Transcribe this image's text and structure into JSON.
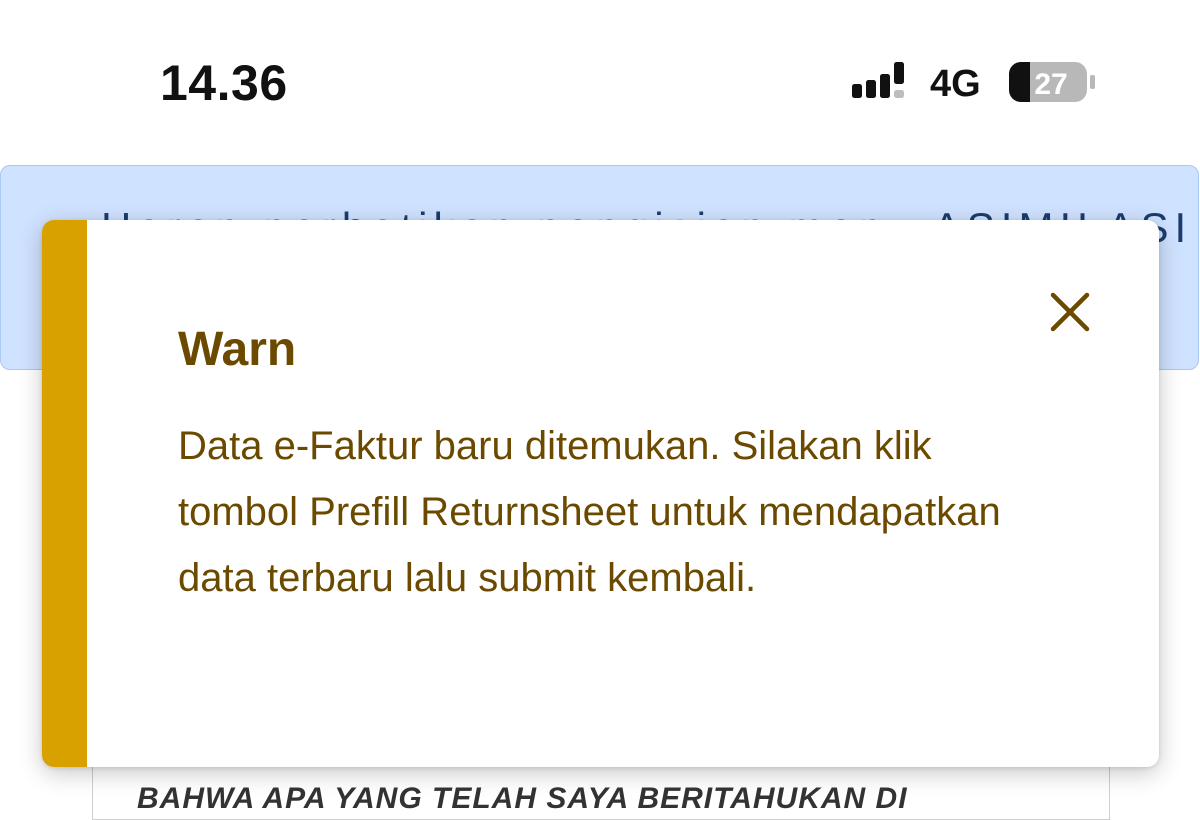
{
  "status_bar": {
    "time": "14.36",
    "network": "4G",
    "battery_level": "27"
  },
  "background": {
    "banner_text": "Harap perhatikan pengisian menu ASIMILASI",
    "declaration_text": "BAHWA APA YANG TELAH SAYA BERITAHUKAN DI"
  },
  "toast": {
    "severity": "warn",
    "accent_color": "#d9a100",
    "text_color": "#6b4a00",
    "title": "Warn",
    "message": "Data e-Faktur baru ditemukan. Silakan klik tombol Prefill Returnsheet untuk mendapatkan data terbaru lalu submit kembali.",
    "close_icon": "close-icon"
  }
}
